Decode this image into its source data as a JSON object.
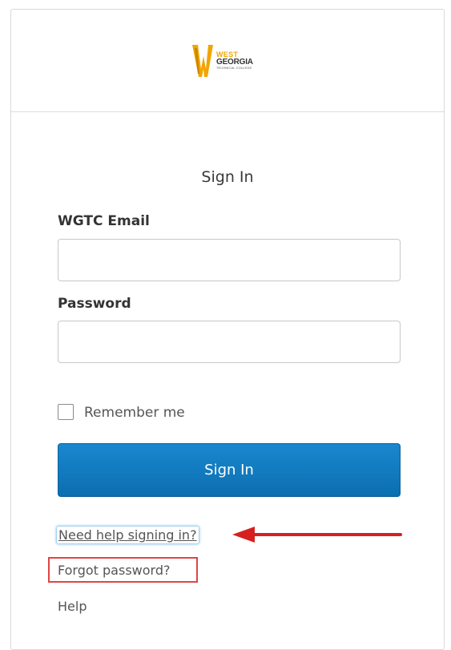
{
  "header": {
    "logo": {
      "line1": "WEST",
      "line2": "GEORGIA",
      "line3": "TECHNICAL COLLEGE"
    }
  },
  "form": {
    "title": "Sign In",
    "email_label": "WGTC Email",
    "email_value": "",
    "password_label": "Password",
    "password_value": "",
    "remember_label": "Remember me",
    "remember_checked": false,
    "submit_label": "Sign In"
  },
  "links": {
    "need_help": "Need help signing in?",
    "forgot_password": "Forgot password?",
    "help": "Help"
  },
  "annotations": {
    "arrow_color": "#d62020",
    "highlight_box_color": "#e04545"
  },
  "colors": {
    "primary_button": "#0e74b8",
    "logo_gold": "#f0a500"
  }
}
